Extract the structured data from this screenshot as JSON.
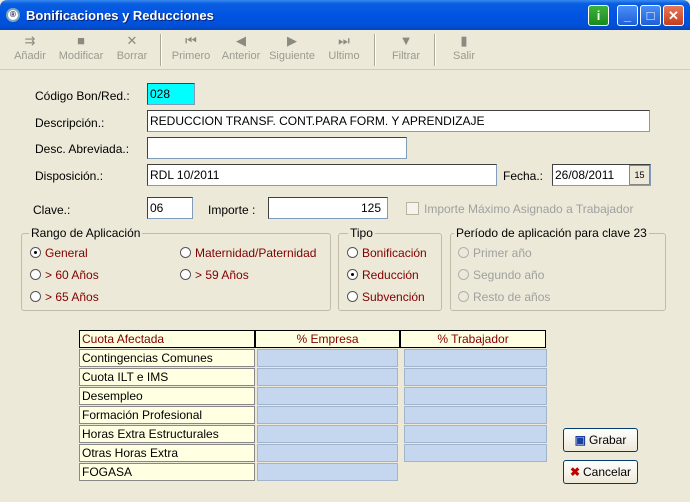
{
  "window": {
    "title": "Bonificaciones y Reducciones"
  },
  "toolbar": {
    "add": "Añadir",
    "modify": "Modificar",
    "delete": "Borrar",
    "first": "Primero",
    "prev": "Anterior",
    "next": "Siguiente",
    "last": "Ultimo",
    "filter": "Filtrar",
    "exit": "Salir"
  },
  "form": {
    "code_label": "Código Bon/Red.:",
    "code_value": "028",
    "desc_label": "Descripción.:",
    "desc_value": "REDUCCION TRANSF. CONT.PARA FORM. Y APRENDIZAJE",
    "short_label": "Desc. Abreviada.:",
    "short_value": "",
    "disp_label": "Disposición.:",
    "disp_value": "RDL 10/2011",
    "date_label": "Fecha.:",
    "date_value": "26/08/2011",
    "cal_icon": "15",
    "clave_label": "Clave.:",
    "clave_value": "06",
    "importe_label": "Importe :",
    "importe_value": "125",
    "max_label": "Importe Máximo Asignado a Trabajador"
  },
  "rango": {
    "title": "Rango de Aplicación",
    "general": "General",
    "over60": "> 60 Años",
    "over65": "> 65 Años",
    "maternidad": "Maternidad/Paternidad",
    "over59": "> 59 Años",
    "selected": "general"
  },
  "tipo": {
    "title": "Tipo",
    "bonificacion": "Bonificación",
    "reduccion": "Reducción",
    "subvencion": "Subvención",
    "selected": "reduccion"
  },
  "periodo": {
    "title": "Período de aplicación para clave 23",
    "first": "Primer año",
    "second": "Segundo año",
    "rest": "Resto de años"
  },
  "grid": {
    "headers": [
      "Cuota Afectada",
      "% Empresa",
      "% Trabajador"
    ],
    "rows": [
      "Contingencias Comunes",
      "Cuota ILT e IMS",
      "Desempleo",
      "Formación Profesional",
      "Horas Extra Estructurales",
      "Otras Horas Extra",
      "FOGASA"
    ]
  },
  "buttons": {
    "save": "Grabar",
    "cancel": "Cancelar"
  }
}
